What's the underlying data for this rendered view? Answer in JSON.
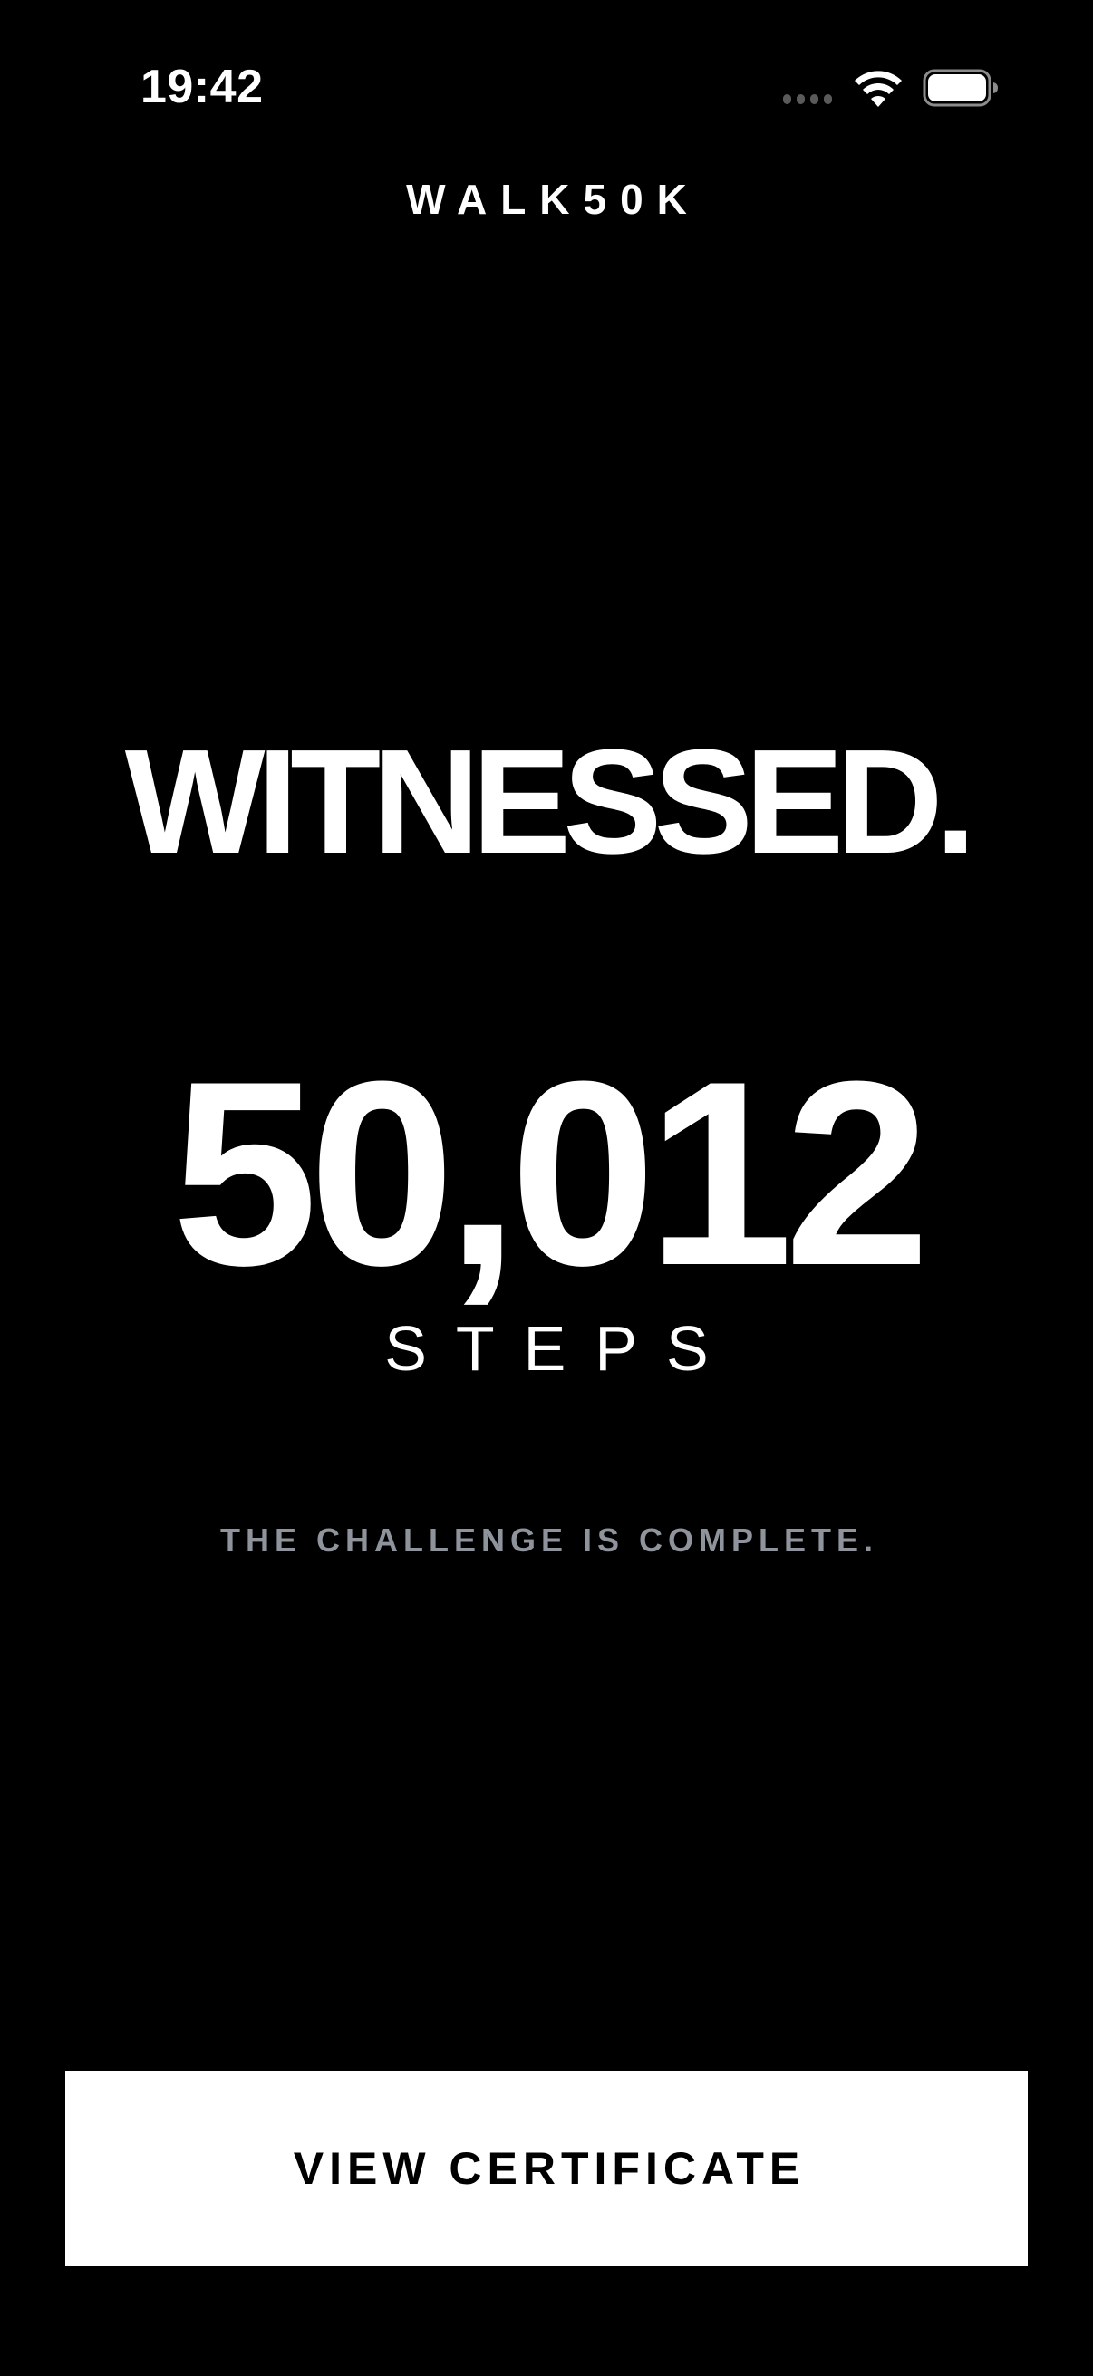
{
  "status_bar": {
    "time": "19:42",
    "icons": [
      "cellular-signal-icon",
      "wifi-icon",
      "battery-icon"
    ]
  },
  "header": {
    "app_title": "WALK50K"
  },
  "main": {
    "headline": "WITNESSED.",
    "step_count": "50,012",
    "steps_label": "STEPS",
    "complete_message": "THE CHALLENGE IS COMPLETE."
  },
  "footer": {
    "cta_label": "VIEW CERTIFICATE"
  },
  "colors": {
    "background": "#000000",
    "text": "#ffffff",
    "muted_text": "#8f939c",
    "button_bg": "#ffffff",
    "button_text": "#000000"
  }
}
